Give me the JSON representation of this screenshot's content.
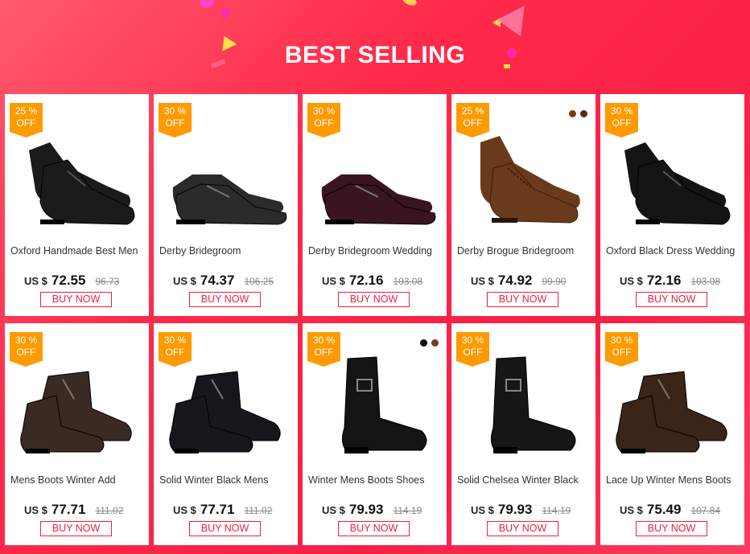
{
  "title": "BEST SELLING",
  "colors": {
    "accent": "#f0203f",
    "badge": "#ff9a00"
  },
  "products": [
    {
      "discount": "25 %",
      "off": "OFF",
      "name": "Oxford Handmade Best Men",
      "currency": "US $",
      "price": "72.55",
      "old_price": "96.73",
      "buy": "BUY NOW",
      "icon": "oxford-shoe-icon",
      "shoe_color": "#1b1b1b",
      "swatches": []
    },
    {
      "discount": "30 %",
      "off": "OFF",
      "name": "Derby Bridegroom",
      "currency": "US $",
      "price": "74.37",
      "old_price": "106.25",
      "buy": "BUY NOW",
      "icon": "derby-shoe-icon",
      "shoe_color": "#2b2b2b",
      "swatches": []
    },
    {
      "discount": "30 %",
      "off": "OFF",
      "name": "Derby Bridegroom Wedding",
      "currency": "US $",
      "price": "72.16",
      "old_price": "103.08",
      "buy": "BUY NOW",
      "icon": "derby-shoe-icon",
      "shoe_color": "#3a1420",
      "swatches": []
    },
    {
      "discount": "25 %",
      "off": "OFF",
      "name": "Derby Brogue Bridegroom",
      "currency": "US $",
      "price": "74.92",
      "old_price": "99.90",
      "buy": "BUY NOW",
      "icon": "brogue-shoe-icon",
      "shoe_color": "#6a3a1c",
      "swatches": [
        "#7a3e14",
        "#5a2a0e"
      ]
    },
    {
      "discount": "30 %",
      "off": "OFF",
      "name": "Oxford Black Dress Wedding",
      "currency": "US $",
      "price": "72.16",
      "old_price": "103.08",
      "buy": "BUY NOW",
      "icon": "oxford-shoe-icon",
      "shoe_color": "#141414",
      "swatches": []
    },
    {
      "discount": "30 %",
      "off": "OFF",
      "name": "Mens Boots Winter Add",
      "currency": "US $",
      "price": "77.71",
      "old_price": "111.02",
      "buy": "BUY NOW",
      "icon": "boot-icon",
      "shoe_color": "#3a2a24",
      "swatches": []
    },
    {
      "discount": "30 %",
      "off": "OFF",
      "name": "Solid Winter Black Mens",
      "currency": "US $",
      "price": "77.71",
      "old_price": "111.02",
      "buy": "BUY NOW",
      "icon": "boot-icon",
      "shoe_color": "#15171c",
      "swatches": []
    },
    {
      "discount": "30 %",
      "off": "OFF",
      "name": "Winter Mens Boots Shoes",
      "currency": "US $",
      "price": "79.93",
      "old_price": "114.19",
      "buy": "BUY NOW",
      "icon": "chelsea-boot-icon",
      "shoe_color": "#141414",
      "swatches": [
        "#111111",
        "#7a3e14"
      ]
    },
    {
      "discount": "30 %",
      "off": "OFF",
      "name": "Solid Chelsea Winter Black",
      "currency": "US $",
      "price": "79.93",
      "old_price": "114.19",
      "buy": "BUY NOW",
      "icon": "chelsea-boot-icon",
      "shoe_color": "#161616",
      "swatches": []
    },
    {
      "discount": "30 %",
      "off": "OFF",
      "name": "Lace Up Winter Mens Boots",
      "currency": "US $",
      "price": "75.49",
      "old_price": "107.84",
      "buy": "BUY NOW",
      "icon": "boot-icon",
      "shoe_color": "#3b2418",
      "swatches": []
    }
  ]
}
